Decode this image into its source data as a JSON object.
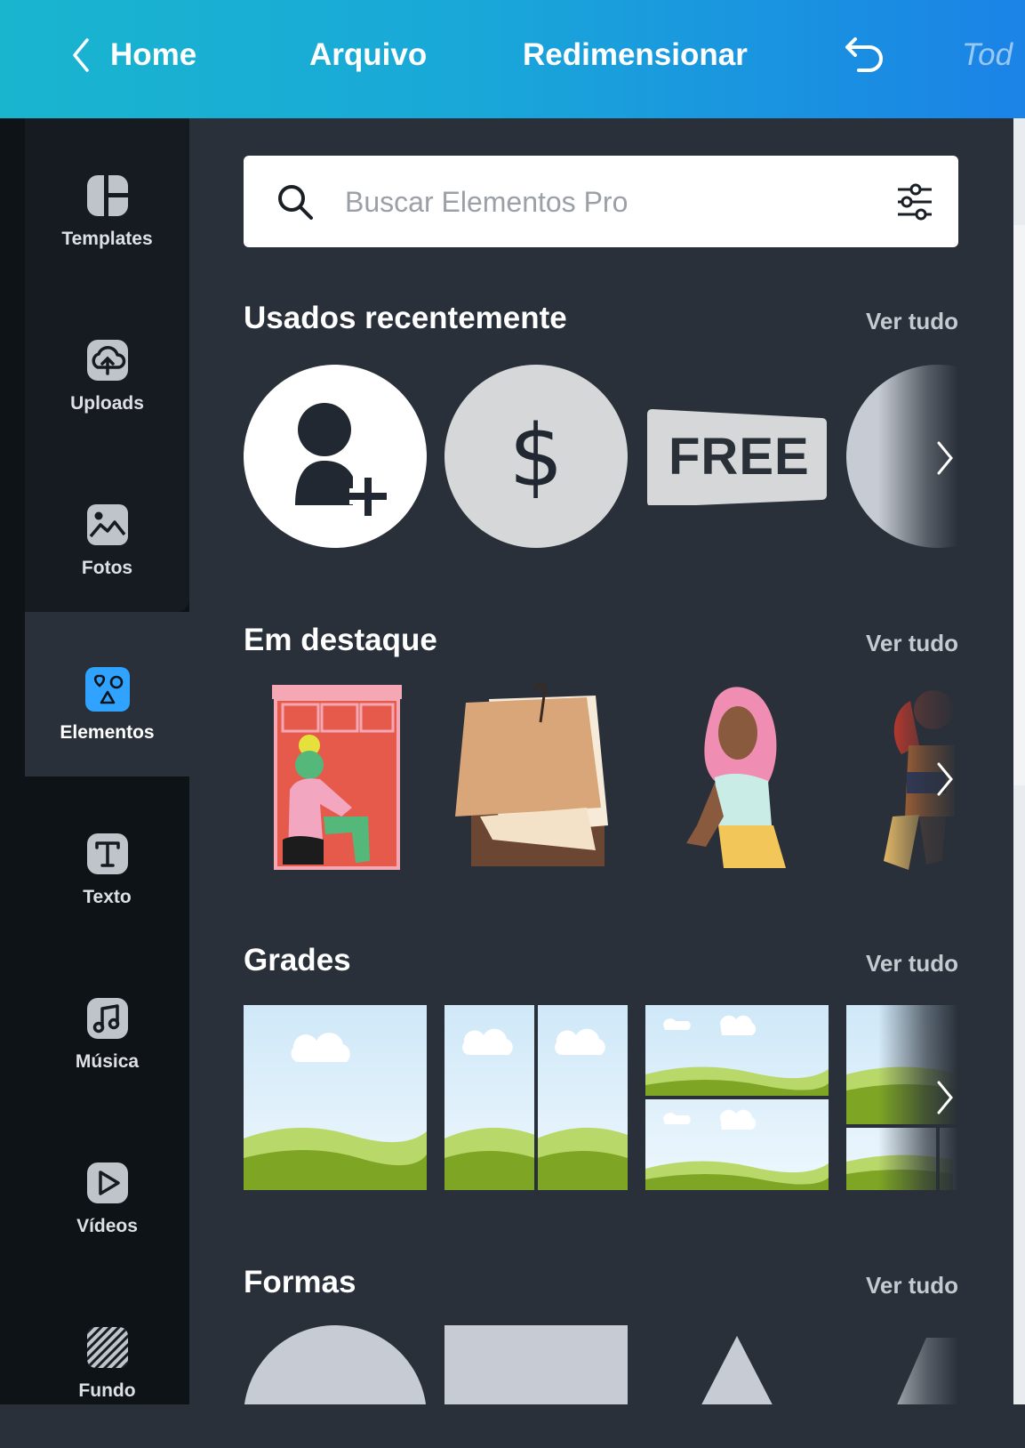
{
  "topbar": {
    "home": "Home",
    "file": "Arquivo",
    "resize": "Redimensionar",
    "all_changes": "Tod"
  },
  "rail": {
    "items": [
      {
        "label": "Templates",
        "icon": "templates-icon"
      },
      {
        "label": "Uploads",
        "icon": "upload-cloud-icon"
      },
      {
        "label": "Fotos",
        "icon": "photo-icon"
      },
      {
        "label": "Elementos",
        "icon": "elements-icon"
      },
      {
        "label": "Texto",
        "icon": "text-icon"
      },
      {
        "label": "Música",
        "icon": "music-icon"
      },
      {
        "label": "Vídeos",
        "icon": "video-icon"
      },
      {
        "label": "Fundo",
        "icon": "background-icon"
      }
    ]
  },
  "search": {
    "placeholder": "Buscar Elementos Pro"
  },
  "sections": {
    "recent": {
      "title": "Usados recentemente",
      "see_all": "Ver tudo",
      "free_label": "FREE",
      "dollar": "$"
    },
    "featured": {
      "title": "Em destaque",
      "see_all": "Ver tudo"
    },
    "grids": {
      "title": "Grades",
      "see_all": "Ver tudo"
    },
    "shapes": {
      "title": "Formas",
      "see_all": "Ver tudo"
    }
  },
  "colors": {
    "accent": "#19b5cf",
    "accent_end": "#1b83e6",
    "panel": "#293039",
    "rail": "#0e1318",
    "active_icon": "#2fa3ff"
  }
}
